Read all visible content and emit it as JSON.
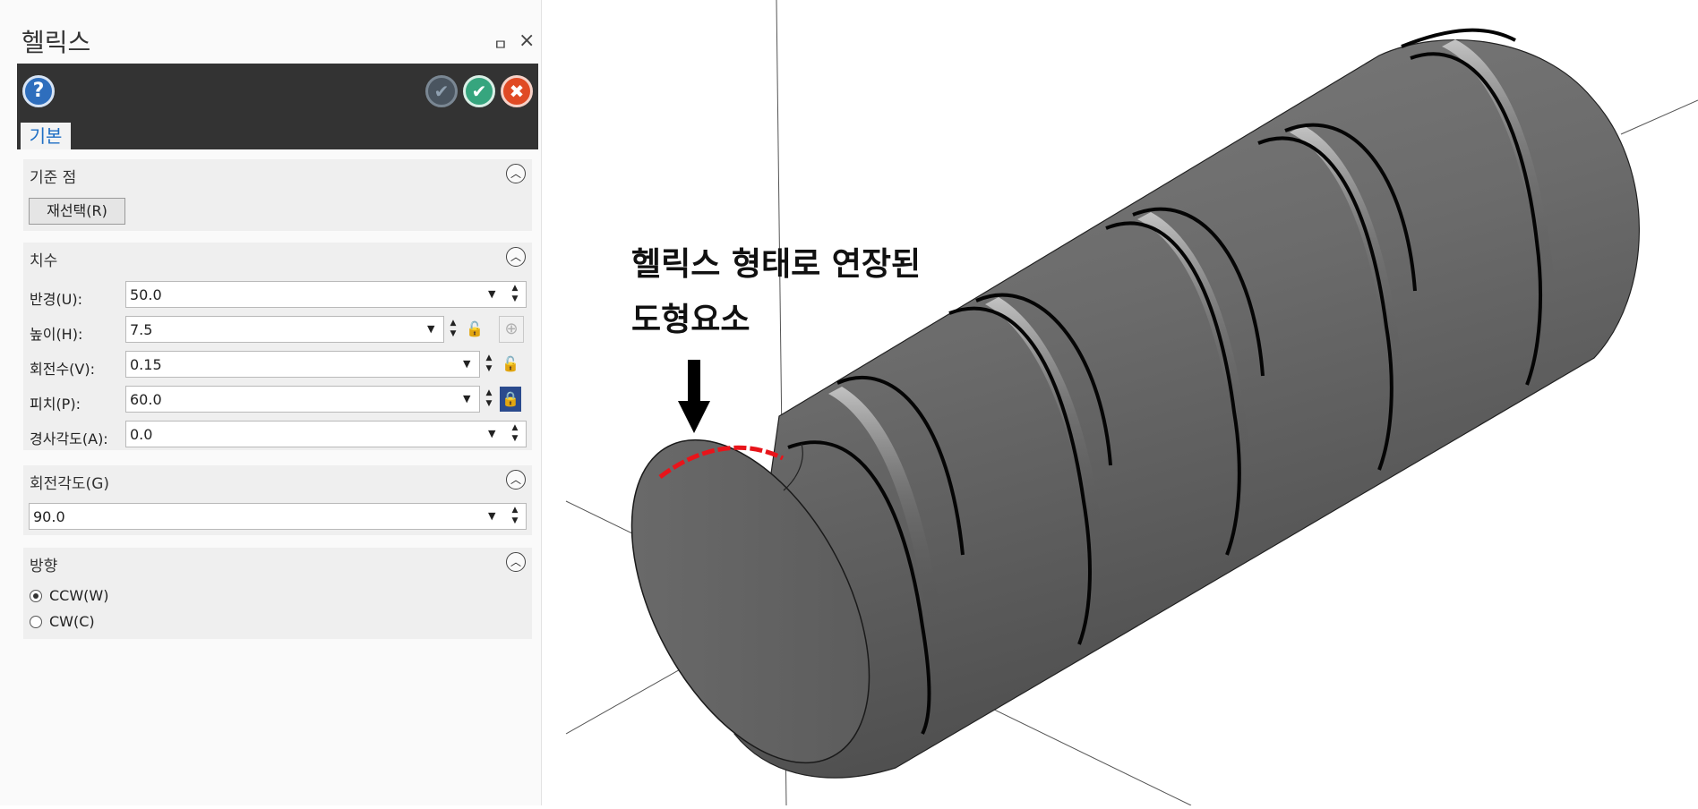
{
  "panel": {
    "title": "헬릭스",
    "pin_glyph": "ㅁ",
    "close_glyph": "×",
    "tab_label": "기본",
    "toolbar": {
      "help_glyph": "?",
      "apply_glyph": "✔",
      "ok_glyph": "✔",
      "cancel_glyph": "✖"
    }
  },
  "sections": {
    "reference_point": {
      "title": "기준 점",
      "reselect_label": "재선택(R)"
    },
    "dimensions": {
      "title": "치수",
      "fields": [
        {
          "label": "반경(U):",
          "value": "50.0"
        },
        {
          "label": "높이(H):",
          "value": "7.5"
        },
        {
          "label": "회전수(V):",
          "value": "0.15"
        },
        {
          "label": "피치(P):",
          "value": "60.0"
        },
        {
          "label": "경사각도(A):",
          "value": "0.0"
        }
      ]
    },
    "rotation_angle": {
      "title": "회전각도(G)",
      "value": "90.0"
    },
    "direction": {
      "title": "방향",
      "options": [
        {
          "label": "CCW(W)",
          "checked": true
        },
        {
          "label": "CW(C)",
          "checked": false
        }
      ]
    }
  },
  "viewport": {
    "annotation_line1": "헬릭스 형태로 연장된",
    "annotation_line2": "도형요소",
    "highlight_color": "#e8141a",
    "body_color": "#6a6a6a"
  },
  "icons": {
    "help": "help-icon",
    "apply": "apply-check-icon",
    "ok": "ok-check-icon",
    "cancel": "cancel-x-icon",
    "lock": "lock-icon",
    "target": "crosshair-icon",
    "collapse": "chevron-up-icon"
  }
}
